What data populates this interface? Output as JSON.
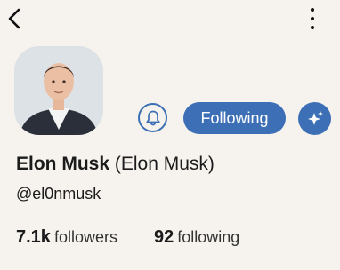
{
  "header": {
    "back_icon": "chevron-left-icon",
    "more_icon": "more-vertical-icon"
  },
  "profile": {
    "avatar_icon": "profile-photo",
    "display_name": "Elon Musk",
    "real_name": "(Elon Musk)",
    "handle": "@el0nmusk"
  },
  "actions": {
    "bell_icon": "bell-icon",
    "follow_label": "Following",
    "sparkle_icon": "sparkle-icon",
    "accent_color": "#3c6fb5"
  },
  "stats": {
    "followers_count": "7.1k",
    "followers_label": "followers",
    "following_count": "92",
    "following_label": "following"
  }
}
